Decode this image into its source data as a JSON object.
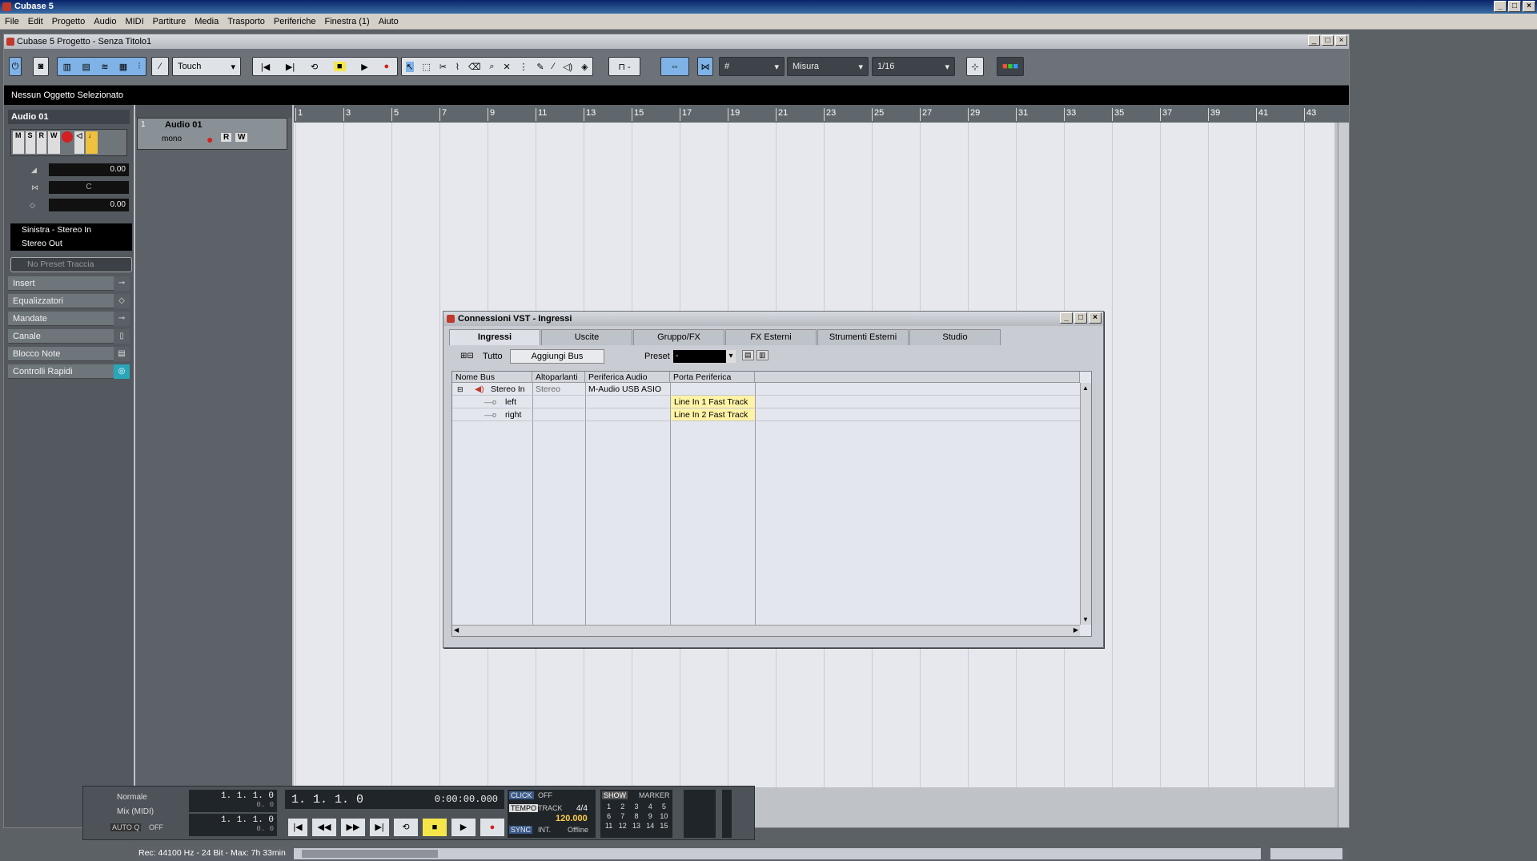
{
  "app": {
    "title": "Cubase 5"
  },
  "menu": [
    "File",
    "Edit",
    "Progetto",
    "Audio",
    "MIDI",
    "Partiture",
    "Media",
    "Trasporto",
    "Periferiche",
    "Finestra (1)",
    "Aiuto"
  ],
  "project": {
    "title": "Cubase 5 Progetto - Senza Titolo1",
    "automation_mode": "Touch",
    "quantize_grid": "Misura",
    "quantize_value": "1/16",
    "info_line": "Nessun Oggetto Selezionato"
  },
  "inspector": {
    "track_name": "Audio 01",
    "volume": "0.00",
    "pan": "C",
    "delay": "0.00",
    "input_routing": "Sinistra - Stereo In",
    "output_routing": "Stereo Out",
    "preset": "No Preset Traccia",
    "sections": [
      "Insert",
      "Equalizzatori",
      "Mandate",
      "Canale",
      "Blocco Note",
      "Controlli Rapidi"
    ]
  },
  "track": {
    "number": "1",
    "name": "Audio 01",
    "mode": "mono"
  },
  "ruler": [
    "1",
    "3",
    "5",
    "7",
    "9",
    "11",
    "13",
    "15",
    "17",
    "19",
    "21",
    "23",
    "25",
    "27",
    "29",
    "31",
    "33",
    "35",
    "37",
    "39",
    "41",
    "43"
  ],
  "transport": {
    "mode_top": "Normale",
    "mode_mid": "Mix (MIDI)",
    "auto_q": "AUTO Q",
    "auto_q_value": "OFF",
    "left_locator": "1. 1. 1.   0",
    "left_sub": "0.   0",
    "right_locator": "1. 1. 1.   0",
    "right_sub": "0.   0",
    "position_bars": "1. 1. 1.   0",
    "position_time": "0:00:00.000",
    "click": "CLICK",
    "click_value": "OFF",
    "tempo_label": "TEMPO",
    "track_label": "TRACK",
    "signature": "4/4",
    "tempo": "120.000",
    "sync": "SYNC",
    "sync_mode": "INT.",
    "sync_status": "Offline",
    "show": "SHOW",
    "marker": "MARKER",
    "markers": [
      "1",
      "2",
      "3",
      "4",
      "5",
      "6",
      "7",
      "8",
      "9",
      "10",
      "11",
      "12",
      "13",
      "14",
      "15"
    ]
  },
  "status": {
    "record_format": "Rec: 44100 Hz - 24 Bit - Max: 7h 33min"
  },
  "vst": {
    "title": "Connessioni VST - Ingressi",
    "tabs": [
      "Ingressi",
      "Uscite",
      "Gruppo/FX",
      "FX Esterni",
      "Strumenti Esterni",
      "Studio"
    ],
    "all_label": "Tutto",
    "add_bus": "Aggiungi Bus",
    "preset_label": "Preset",
    "preset_value": "-",
    "columns": [
      "Nome Bus",
      "Altoparlanti",
      "Periferica Audio",
      "Porta Periferica"
    ],
    "rows": [
      {
        "name": "Stereo In",
        "speakers": "Stereo",
        "device": "M-Audio USB ASIO",
        "port": ""
      },
      {
        "name": "left",
        "speakers": "",
        "device": "",
        "port": "Line In 1 Fast Track"
      },
      {
        "name": "right",
        "speakers": "",
        "device": "",
        "port": "Line In 2 Fast Track"
      }
    ]
  },
  "colors": {
    "title_bar": "#0a246a",
    "port_highlight": "#fff3a6",
    "record": "#d42020",
    "stop_active": "#f4e64a"
  }
}
